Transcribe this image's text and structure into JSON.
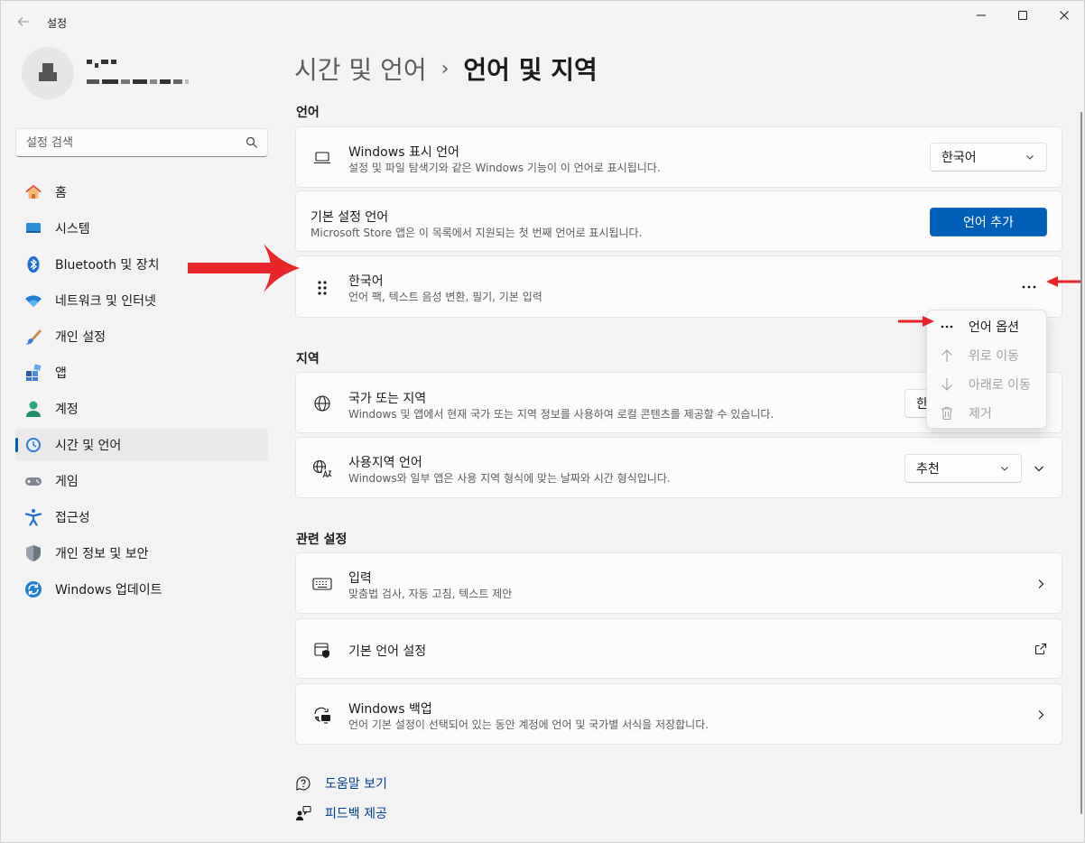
{
  "window": {
    "title": "설정"
  },
  "profile": {
    "name": "",
    "email": ""
  },
  "search": {
    "placeholder": "설정 검색"
  },
  "nav": {
    "items": [
      {
        "label": "홈",
        "icon": "home-icon"
      },
      {
        "label": "시스템",
        "icon": "system-icon"
      },
      {
        "label": "Bluetooth 및 장치",
        "icon": "bluetooth-icon"
      },
      {
        "label": "네트워크 및 인터넷",
        "icon": "wifi-icon"
      },
      {
        "label": "개인 설정",
        "icon": "brush-icon"
      },
      {
        "label": "앱",
        "icon": "apps-icon"
      },
      {
        "label": "계정",
        "icon": "account-icon"
      },
      {
        "label": "시간 및 언어",
        "icon": "time-language-icon"
      },
      {
        "label": "게임",
        "icon": "gamepad-icon"
      },
      {
        "label": "접근성",
        "icon": "accessibility-icon"
      },
      {
        "label": "개인 정보 및 보안",
        "icon": "shield-icon"
      },
      {
        "label": "Windows 업데이트",
        "icon": "update-icon"
      }
    ],
    "active_index": 7
  },
  "breadcrumb": {
    "parent": "시간 및 언어",
    "separator": "›",
    "current": "언어 및 지역"
  },
  "language_section": {
    "title": "언어",
    "display_language": {
      "title": "Windows 표시 언어",
      "desc": "설정 및 파일 탐색기와 같은 Windows 기능이 이 언어로 표시됩니다.",
      "value": "한국어"
    },
    "preferred": {
      "title": "기본 설정 언어",
      "desc": "Microsoft Store 앱은 이 목록에서 지원되는 첫 번째 언어로 표시됩니다.",
      "button": "언어 추가"
    },
    "korean": {
      "title": "한국어",
      "desc": "언어 팩, 텍스트 음성 변환, 필기, 기본 입력",
      "more": "···"
    }
  },
  "context_menu": {
    "items": [
      {
        "label": "언어 옵션",
        "icon": "more-icon",
        "enabled": true
      },
      {
        "label": "위로 이동",
        "icon": "arrow-up-icon",
        "enabled": false
      },
      {
        "label": "아래로 이동",
        "icon": "arrow-down-icon",
        "enabled": false
      },
      {
        "label": "제거",
        "icon": "trash-icon",
        "enabled": false
      }
    ]
  },
  "region_section": {
    "title": "지역",
    "country": {
      "title": "국가 또는 지역",
      "desc": "Windows 및 앱에서 현재 국가 또는 지역 정보를 사용하여 로컬 콘텐츠를 제공할 수 있습니다.",
      "value": "한"
    },
    "format": {
      "title": "사용지역 언어",
      "desc": "Windows와 일부 앱은 사용 지역 형식에 맞는 날짜와 시간 형식입니다.",
      "value": "추천"
    }
  },
  "related_section": {
    "title": "관련 설정",
    "typing": {
      "title": "입력",
      "desc": "맞춤법 검사, 자동 고침, 텍스트 제안"
    },
    "admin": {
      "title": "기본 언어 설정"
    },
    "backup": {
      "title": "Windows 백업",
      "desc": "언어 기본 설정이 선택되어 있는 동안 계정에 언어 및 국가별 서식을 저장합니다."
    }
  },
  "footer": {
    "help": "도움말 보기",
    "feedback": "피드백 제공"
  },
  "colors": {
    "accent": "#005fb8",
    "annotation_arrow": "#e8252a"
  }
}
